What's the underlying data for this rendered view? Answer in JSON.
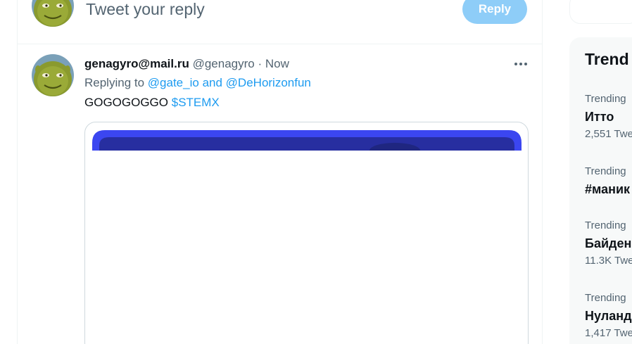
{
  "composer": {
    "placeholder": "Tweet your reply",
    "reply_label": "Reply"
  },
  "tweet": {
    "display_name": "genagyro@mail.ru",
    "handle": "@genagyro",
    "separator": "·",
    "time": "Now",
    "replying_prefix": "Replying to",
    "replying_to_1": "@gate_io",
    "replying_joiner": "and",
    "replying_to_2": "@DeHorizonfun",
    "text": "GOGOGOGGO",
    "cashtag": "$STEMX",
    "more_icon": "more-horizontal-icon"
  },
  "trends": {
    "title": "Trend",
    "items": [
      {
        "meta": "Trending",
        "name": "Итто",
        "count": "2,551 Twe"
      },
      {
        "meta": "Trending",
        "name": "#маник",
        "count": ""
      },
      {
        "meta": "Trending",
        "name": "Байден",
        "count": "11.3K Twe"
      },
      {
        "meta": "Trending",
        "name": "Нуланд",
        "count": "1,417 Twe"
      }
    ]
  },
  "colors": {
    "accent": "#1d9bf0",
    "reply_button_disabled": "#8ecdf8",
    "media_blue": "#3b46f0",
    "media_dark": "#272ea0"
  }
}
